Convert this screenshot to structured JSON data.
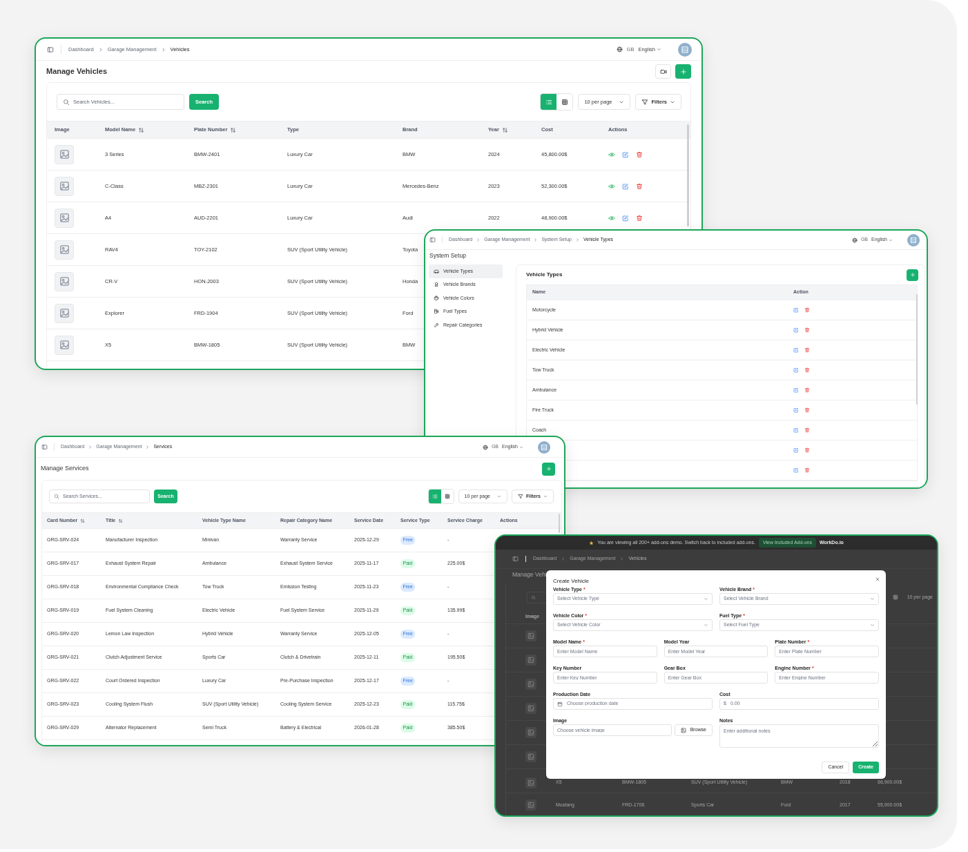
{
  "vehicles_window": {
    "breadcrumb": [
      "Dashboard",
      "Garage Management",
      "Vehicles"
    ],
    "language_code": "GB",
    "language": "English",
    "title": "Manage Vehicles",
    "search": {
      "placeholder": "Search Vehicles..."
    },
    "search_button": "Search",
    "view_modes": [
      {
        "selected": true
      },
      {
        "selected": false
      }
    ],
    "per_page": "10 per page",
    "filters": "Filters",
    "image_column": "Image",
    "columns": [
      {
        "label": "Model Name",
        "sortable": true
      },
      {
        "label": "Plate Number",
        "sortable": true
      },
      {
        "label": "Type",
        "sortable": false
      },
      {
        "label": "Brand",
        "sortable": false
      },
      {
        "label": "Year",
        "sortable": true
      },
      {
        "label": "Cost",
        "sortable": false
      },
      {
        "label": "Actions",
        "sortable": false
      }
    ],
    "rows": [
      {
        "cells": [
          "3 Series",
          "BMW-2401",
          "Luxury Car",
          "BMW",
          "2024",
          "45,800.00$"
        ],
        "actions": true
      },
      {
        "cells": [
          "C-Class",
          "MBZ-2301",
          "Luxury Car",
          "Mercedes-Benz",
          "2023",
          "52,300.00$"
        ],
        "actions": true
      },
      {
        "cells": [
          "A4",
          "AUD-2201",
          "Luxury Car",
          "Audi",
          "2022",
          "48,900.00$"
        ],
        "actions": true
      },
      {
        "cells": [
          "RAV4",
          "TOY-2102",
          "SUV (Sport Utility Vehicle)",
          "Toyota"
        ]
      },
      {
        "cells": [
          "CR-V",
          "HON-2003",
          "SUV (Sport Utility Vehicle)",
          "Honda"
        ]
      },
      {
        "cells": [
          "Explorer",
          "FRD-1904",
          "SUV (Sport Utility Vehicle)",
          "Ford"
        ]
      },
      {
        "cells": [
          "X5",
          "BMW-1805",
          "SUV (Sport Utility Vehicle)",
          "BMW"
        ]
      }
    ]
  },
  "system_setup_window": {
    "breadcrumb": [
      "Dashboard",
      "Garage Management",
      "System Setup",
      "Vehicle Types"
    ],
    "language_code": "GB",
    "language": "English",
    "title": "System Setup",
    "menu": [
      {
        "label": "Vehicle Types",
        "selected": true
      },
      {
        "label": "Vehicle Brands",
        "selected": false
      },
      {
        "label": "Vehicle Colors",
        "selected": false
      },
      {
        "label": "Fuel Types",
        "selected": false
      },
      {
        "label": "Repair Categories",
        "selected": false
      }
    ],
    "panel_title": "Vehicle Types",
    "columns": [
      "Name",
      "Action"
    ],
    "rows": [
      {
        "name": "Motorcycle",
        "actions": true
      },
      {
        "name": "Hybrid Vehicle",
        "actions": true
      },
      {
        "name": "Electric Vehicle",
        "actions": true
      },
      {
        "name": "Tow Truck",
        "actions": true
      },
      {
        "name": "Ambulance",
        "actions": true
      },
      {
        "name": "Fire Truck",
        "actions": true
      },
      {
        "name": "Coach",
        "actions": true
      },
      {
        "actions": true
      },
      {
        "actions": true
      }
    ]
  },
  "services_window": {
    "breadcrumb": [
      "Dashboard",
      "Garage Management",
      "Services"
    ],
    "language_code": "GB",
    "language": "English",
    "title": "Manage Services",
    "search": {
      "placeholder": "Search Services..."
    },
    "search_button": "Search",
    "view_modes": [
      {
        "selected": true
      },
      {
        "selected": false
      }
    ],
    "per_page": "10 per page",
    "filters": "Filters",
    "columns": [
      {
        "label": "Card Number",
        "sortable": true
      },
      {
        "label": "Title",
        "sortable": true
      },
      {
        "label": "Vehicle Type Name",
        "sortable": false
      },
      {
        "label": "Repair Category Name",
        "sortable": false
      },
      {
        "label": "Service Date",
        "sortable": false
      },
      {
        "label": "Service Type",
        "sortable": false
      },
      {
        "label": "Service Charge",
        "sortable": false
      },
      {
        "label": "Actions",
        "sortable": false
      }
    ],
    "rows": [
      {
        "cells": [
          "GRG-SRV-024",
          "Manufacturer Inspection",
          "Minivan",
          "Warranty Service",
          "2025-12-29",
          "Free",
          "-"
        ],
        "paid": false
      },
      {
        "cells": [
          "GRG-SRV-017",
          "Exhaust System Repair",
          "Ambulance",
          "Exhaust System Service",
          "2025-11-17",
          "Paid",
          "225.00$"
        ],
        "paid": true
      },
      {
        "cells": [
          "GRG-SRV-018",
          "Environmental Compliance Check",
          "Tow Truck",
          "Emission Testing",
          "2025-11-23",
          "Free",
          "-"
        ],
        "paid": false
      },
      {
        "cells": [
          "GRG-SRV-019",
          "Fuel System Cleaning",
          "Electric Vehicle",
          "Fuel System Service",
          "2025-11-29",
          "Paid",
          "135.99$"
        ],
        "paid": true
      },
      {
        "cells": [
          "GRG-SRV-020",
          "Lemon Law Inspection",
          "Hybrid Vehicle",
          "Warranty Service",
          "2025-12-05",
          "Free",
          "-"
        ],
        "paid": false
      },
      {
        "cells": [
          "GRG-SRV-021",
          "Clutch Adjustment Service",
          "Sports Car",
          "Clutch & Drivetrain",
          "2025-12-11",
          "Paid",
          "195.50$"
        ],
        "paid": true
      },
      {
        "cells": [
          "GRG-SRV-022",
          "Court Ordered Inspection",
          "Luxury Car",
          "Pre-Purchase Inspection",
          "2025-12-17",
          "Free",
          "-"
        ],
        "paid": false
      },
      {
        "cells": [
          "GRG-SRV-023",
          "Cooling System Flush",
          "SUV (Sport Utility Vehicle)",
          "Cooling System Service",
          "2025-12-23",
          "Paid",
          "115.75$"
        ],
        "paid": true
      },
      {
        "cells": [
          "GRG-SRV-029",
          "Alternator Replacement",
          "Semi Truck",
          "Battery & Electrical",
          "2026-01-28",
          "Paid",
          "385.50$"
        ],
        "paid": true
      }
    ]
  },
  "create_vehicle_window": {
    "banner": {
      "text": "You are viewing all 200+ add-ons demo. Switch back to included add-ons.",
      "button": "View Included Add-ons",
      "brand": "WorkDo.io"
    },
    "breadcrumb": [
      "Dashboard",
      "Garage Management",
      "Vehicles"
    ],
    "title": "Manage Vehi",
    "per_page": "10 per page",
    "image_column": "Image",
    "rows": [
      {
        "thumbnail": true
      },
      {
        "thumbnail": true
      },
      {
        "thumbnail": true
      },
      {
        "thumbnail": true
      },
      {
        "thumbnail": true
      },
      {
        "thumbnail": true
      },
      {
        "thumbnail": true,
        "cells": [
          "X5",
          "BMW-1805",
          "SUV (Sport Utility Vehicle)",
          "BMW",
          "2018",
          "66,900.00$"
        ]
      },
      {
        "thumbnail": true,
        "cells": [
          "Mustang",
          "FRD-1706",
          "Sports Car",
          "Ford",
          "2017",
          "55,900.00$"
        ]
      }
    ],
    "dialog": {
      "title": "Create Vehicle",
      "rows": [
        [
          {
            "kind": "select",
            "label": "Vehicle Type",
            "required_mark": "*",
            "placeholder": "Select Vehicle Type"
          },
          {
            "kind": "select",
            "label": "Vehicle Brand",
            "required_mark": "*",
            "placeholder": "Select Vehicle Brand"
          }
        ],
        [
          {
            "kind": "select",
            "label": "Vehicle Color",
            "required_mark": "*",
            "placeholder": "Select Vehicle Color"
          },
          {
            "kind": "select",
            "label": "Fuel Type",
            "required_mark": "*",
            "placeholder": "Select Fuel Type"
          }
        ],
        [
          {
            "kind": "input",
            "label": "Model Name",
            "required_mark": "*",
            "placeholder": "Enter Model Name"
          },
          {
            "kind": "input",
            "label": "Model Year",
            "placeholder": "Enter Model Year"
          },
          {
            "kind": "input",
            "label": "Plate Number",
            "required_mark": "*",
            "placeholder": "Enter Plate Number"
          }
        ],
        [
          {
            "kind": "input",
            "label": "Key Number",
            "placeholder": "Enter Key Number"
          },
          {
            "kind": "input",
            "label": "Gear Box",
            "placeholder": "Enter Gear Box"
          },
          {
            "kind": "input",
            "label": "Engine Number",
            "required_mark": "*",
            "placeholder": "Enter Engine Number"
          }
        ],
        [
          {
            "kind": "date",
            "label": "Production Date",
            "placeholder": "Choose production date"
          },
          {
            "kind": "money",
            "label": "Cost",
            "prefix": "$",
            "placeholder": "0.00"
          }
        ],
        [
          {
            "kind": "file",
            "label": "Image",
            "placeholder": "Choose vehicle image",
            "button": "Browse"
          },
          {
            "kind": "textarea",
            "label": "Notes",
            "placeholder": "Enter additional notes"
          }
        ]
      ],
      "cancel": "Cancel",
      "submit": "Create"
    }
  }
}
